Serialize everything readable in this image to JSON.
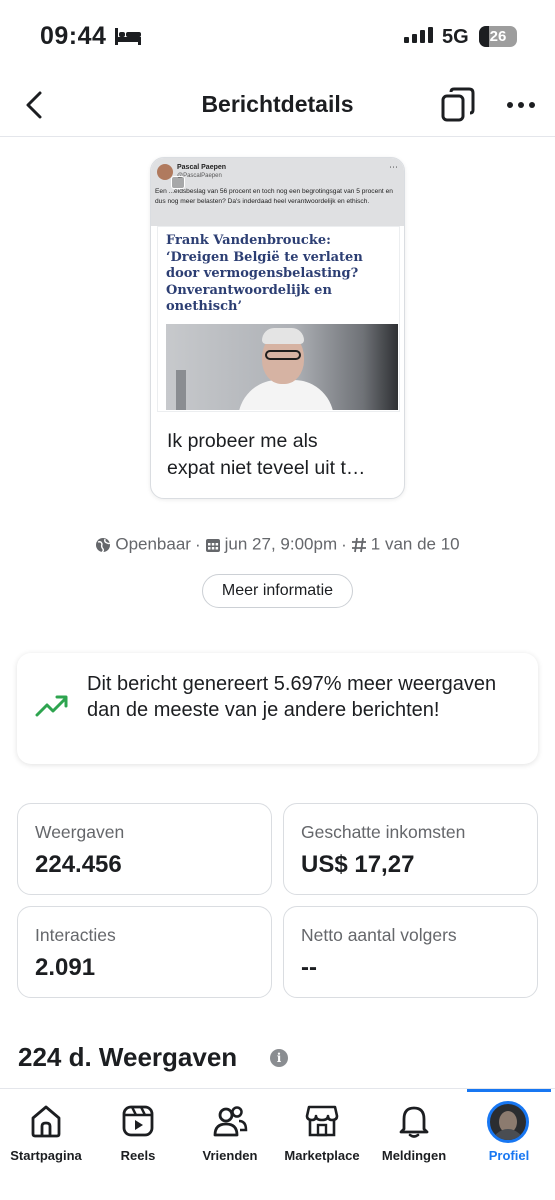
{
  "status_bar": {
    "time": "09:44",
    "network": "5G",
    "battery": "26",
    "battery_level_percent": 26
  },
  "header": {
    "title": "Berichtdetails"
  },
  "post": {
    "tweet_author": "Pascal Paepen",
    "tweet_handle": "@PascalPaepen",
    "tweet_text": "Een ...eidsbeslag van 56 procent en toch nog een begrotingsgat van 5 procent en dus nog meer belasten? Da's inderdaad heel verantwoordelijk en ethisch.",
    "article_headline": "Frank Vandenbroucke: ‘Dreigen België te verlaten door vermogensbelasting? Onverantwoordelijk en onethisch’",
    "caption_line1": "Ik probeer me als",
    "caption_line2": "expat niet teveel uit t…"
  },
  "meta": {
    "audience": "Openbaar",
    "date": "jun 27, 9:00pm",
    "rank": "1 van de 10",
    "more_info": "Meer informatie"
  },
  "insight": {
    "text": "Dit bericht genereert 5.697% meer weergaven dan de meeste van je andere berichten!",
    "accent_color": "#2ea44f"
  },
  "stats": [
    {
      "label": "Weergaven",
      "value": "224.456"
    },
    {
      "label": "Geschatte inkomsten",
      "value": "US$ 17,27"
    },
    {
      "label": "Interacties",
      "value": "2.091"
    },
    {
      "label": "Netto aantal volgers",
      "value": "--"
    }
  ],
  "section": {
    "title": "224 d. Weergaven",
    "info_icon": "i"
  },
  "bottom_nav": {
    "active_color": "#1877f2",
    "items": [
      {
        "label": "Startpagina",
        "icon": "home-icon"
      },
      {
        "label": "Reels",
        "icon": "reels-icon"
      },
      {
        "label": "Vrienden",
        "icon": "friends-icon"
      },
      {
        "label": "Marketplace",
        "icon": "marketplace-icon"
      },
      {
        "label": "Meldingen",
        "icon": "bell-icon"
      },
      {
        "label": "Profiel",
        "icon": "profile-avatar"
      }
    ]
  }
}
